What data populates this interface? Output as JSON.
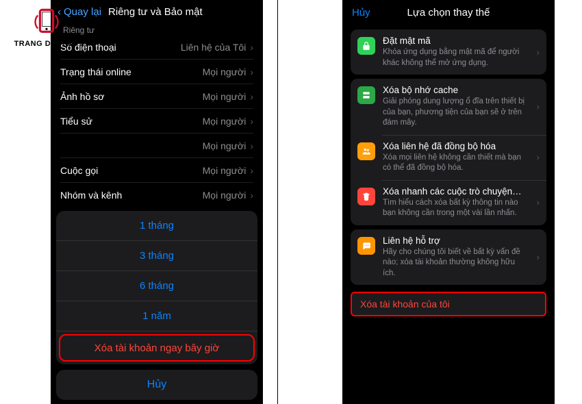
{
  "logo": {
    "brand": "TRANG DICH VU"
  },
  "left": {
    "back_label": "Quay lại",
    "title": "Riêng tư và Bảo mật",
    "section_label": "Riêng tư",
    "rows": [
      {
        "label": "Số điện thoại",
        "value": "Liên hệ của Tôi"
      },
      {
        "label": "Trạng thái online",
        "value": "Mọi người"
      },
      {
        "label": "Ảnh hồ sơ",
        "value": "Mọi người"
      },
      {
        "label": "Tiểu sử",
        "value": "Mọi người"
      },
      {
        "label": "",
        "value": "Mọi người"
      },
      {
        "label": "Cuộc gọi",
        "value": "Mọi người"
      },
      {
        "label": "Nhóm và kênh",
        "value": "Mọi người"
      }
    ],
    "sheet": {
      "opt1": "1 tháng",
      "opt2": "3 tháng",
      "opt3": "6 tháng",
      "opt4": "1 năm",
      "delete": "Xóa tài khoản ngay bây giờ",
      "cancel": "Hủy"
    }
  },
  "right": {
    "cancel_label": "Hủy",
    "title": "Lựa chọn thay thế",
    "item_passcode": {
      "title": "Đặt mật mã",
      "desc": "Khóa ứng dụng bằng mật mã để người khác không thể mở ứng dụng."
    },
    "item_cache": {
      "title": "Xóa bộ nhớ cache",
      "desc": "Giải phóng dung lượng ổ đĩa trên thiết bị của bạn, phương tiện của bạn sẽ ở trên đám mây."
    },
    "item_contacts": {
      "title": "Xóa liên hệ đã đồng bộ hóa",
      "desc": "Xóa mọi liên hệ không cần thiết mà bạn có thể đã đồng bộ hóa."
    },
    "item_chats": {
      "title": "Xóa nhanh các cuộc trò chuyện…",
      "desc": "Tìm hiểu cách xóa bất kỳ thông tin nào bạn không cần trong một vài lần nhấn."
    },
    "item_support": {
      "title": "Liên hệ hỗ trợ",
      "desc": "Hãy cho chúng tôi biết về bất kỳ vấn đề nào; xóa tài khoản thường không hữu ích."
    },
    "delete_label": "Xóa tài khoản của tôi"
  }
}
